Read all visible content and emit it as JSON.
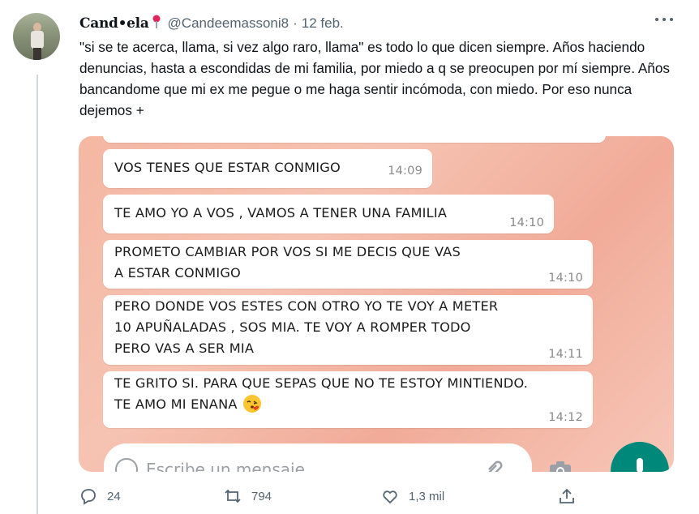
{
  "tweet": {
    "display_name": "Cand•ela",
    "handle": "@Candeemassoni8",
    "date": "12 feb.",
    "text": "\"si se te acerca, llama, si vez algo raro, llama\" es todo lo que dicen siempre. Años haciendo denuncias, hasta a escondidas de mi familia, por miedo a q se preocupen por mí siempre. Años bancandome que mi ex me pegue o me haga sentir incómoda, con miedo. Por eso nunca dejemos +",
    "colors": {
      "accent": "#1d9bf0",
      "muted": "#536471",
      "thread_line": "#cfd9de"
    }
  },
  "chat": {
    "messages": [
      {
        "text": "VOS TENES QUE ESTAR CONMIGO",
        "time": "14:09"
      },
      {
        "text": "TE AMO YO A VOS , VAMOS A TENER UNA FAMILIA",
        "time": "14:10"
      },
      {
        "text": "PROMETO CAMBIAR POR VOS SI ME DECIS QUE VAS\nA ESTAR CONMIGO",
        "time": "14:10"
      },
      {
        "text": "PERO DONDE VOS ESTES CON OTRO YO TE VOY A METER\n10 APUÑALADAS , SOS MIA. TE VOY A ROMPER TODO\nPERO VAS A SER MIA",
        "time": "14:11"
      },
      {
        "text": "TE GRITO SI. PARA QUE SEPAS QUE NO TE ESTOY MINTIENDO.\nTE AMO MI ENANA",
        "time": "14:12",
        "emoji": "kiss-face-icon"
      }
    ],
    "compose_placeholder": "Escribe un mensaje",
    "colors": {
      "background": "#f4b7a2",
      "fab": "#00897b"
    }
  },
  "actions": {
    "reply_count": "24",
    "retweet_count": "794",
    "like_count": "1,3 mil"
  }
}
